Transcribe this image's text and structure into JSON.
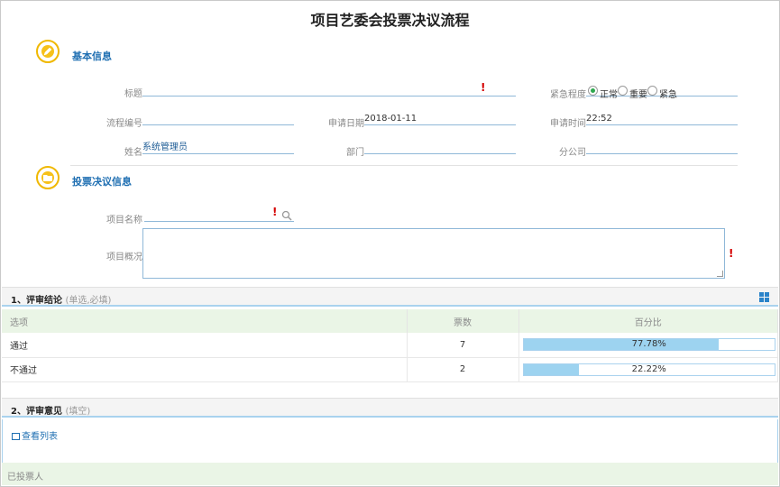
{
  "page": {
    "title": "项目艺委会投票决议流程"
  },
  "basic": {
    "title": "基本信息",
    "subject_label": "标题",
    "subject_value": "",
    "urgency_label": "紧急程度",
    "urgency_options": [
      "正常",
      "重要",
      "紧急"
    ],
    "urgency_selected": "正常",
    "flow_no_label": "流程编号",
    "flow_no_value": "",
    "apply_date_label": "申请日期",
    "apply_date_value": "2018-01-11",
    "apply_time_label": "申请时间",
    "apply_time_value": "22:52",
    "name_label": "姓名",
    "name_value": "系统管理员",
    "dept_label": "部门",
    "dept_value": "",
    "branch_label": "分公司",
    "branch_value": ""
  },
  "vote": {
    "title": "投票决议信息",
    "project_name_label": "项目名称",
    "project_name_value": "",
    "project_summary_label": "项目概况",
    "project_summary_value": ""
  },
  "conclusion": {
    "title": "1、评审结论",
    "hint": "(单选,必填)",
    "columns": [
      "选项",
      "票数",
      "百分比"
    ],
    "rows": [
      {
        "option": "通过",
        "votes": "7",
        "percent_label": "77.78%",
        "percent": 77.78
      },
      {
        "option": "不通过",
        "votes": "2",
        "percent_label": "22.22%",
        "percent": 22.22
      }
    ]
  },
  "opinion": {
    "title": "2、评审意见",
    "hint": "(填空)",
    "view_list": "查看列表"
  },
  "footer": {
    "voted_label": "已投票人"
  },
  "colors": {
    "accent": "#1f6fb2",
    "icon_yellow": "#f6c11a",
    "bar_fill": "#9dd3f0",
    "header_green": "#eaf5e6",
    "required": "#d40000"
  },
  "icons": {
    "basic_section": "pencil-icon",
    "vote_section": "folder-icon",
    "search": "search-icon",
    "grid": "grid-icon",
    "list": "list-icon"
  }
}
